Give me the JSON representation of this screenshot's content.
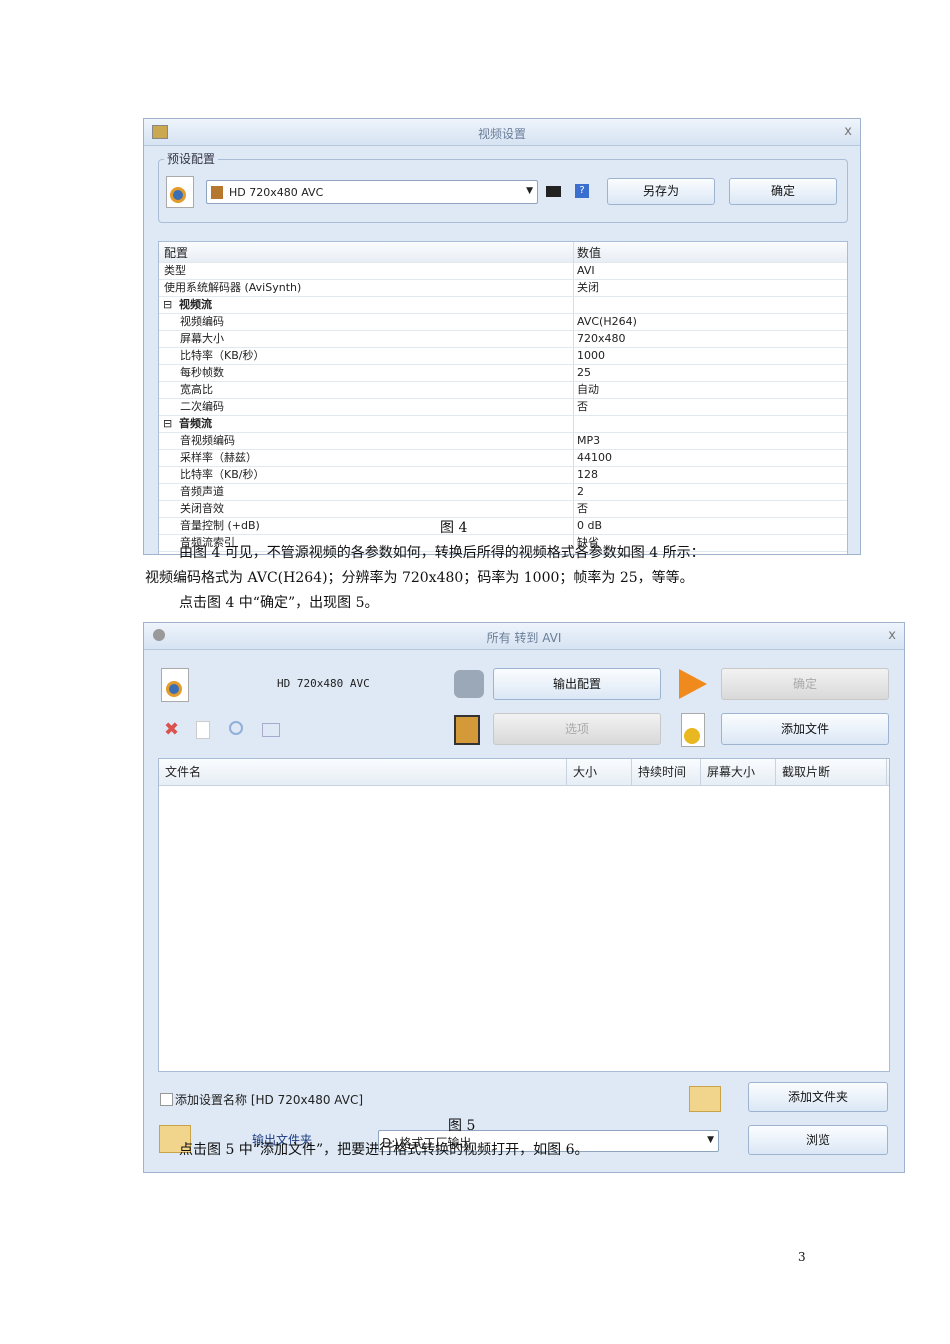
{
  "figure4": {
    "title": "视频设置",
    "close": "x",
    "preset_group": "预设配置",
    "preset_value": "HD 720x480 AVC",
    "save_as": "另存为",
    "ok": "确定",
    "help": "?",
    "col_config": "配置",
    "col_value": "数值",
    "rows": [
      {
        "k": "类型",
        "v": "AVI"
      },
      {
        "k": "使用系统解码器 (AviSynth)",
        "v": "关闭"
      },
      {
        "k": "视频流",
        "v": "",
        "section": true
      },
      {
        "k": "视频编码",
        "v": "AVC(H264)",
        "indent": true
      },
      {
        "k": "屏幕大小",
        "v": "720x480",
        "indent": true
      },
      {
        "k": "比特率（KB/秒）",
        "v": "1000",
        "indent": true
      },
      {
        "k": "每秒帧数",
        "v": "25",
        "indent": true
      },
      {
        "k": "宽高比",
        "v": "自动",
        "indent": true
      },
      {
        "k": "二次编码",
        "v": "否",
        "indent": true
      },
      {
        "k": "音频流",
        "v": "",
        "section": true
      },
      {
        "k": "音视频编码",
        "v": "MP3",
        "indent": true
      },
      {
        "k": "采样率（赫兹）",
        "v": "44100",
        "indent": true
      },
      {
        "k": "比特率（KB/秒）",
        "v": "128",
        "indent": true
      },
      {
        "k": "音频声道",
        "v": "2",
        "indent": true
      },
      {
        "k": "关闭音效",
        "v": "否",
        "indent": true
      },
      {
        "k": "音量控制 (+dB)",
        "v": "0 dB",
        "indent": true
      },
      {
        "k": "音频流索引",
        "v": "缺省",
        "indent": true
      }
    ],
    "caption": "图 4"
  },
  "text": {
    "p1": "由图 4 可见，不管源视频的各参数如何，转换后所得的视频格式各参数如图 4 所示：",
    "p2": "视频编码格式为 AVC(H264)；分辨率为 720x480；码率为 1000；帧率为 25，等等。",
    "p3": "点击图 4 中“确定”，出现图 5。",
    "p4": "点击图 5 中“添加文件”，把要进行格式转换的视频打开，如图 6。",
    "page_number": "3"
  },
  "figure5": {
    "title": "所有 转到 AVI",
    "close": "x",
    "preset": "HD 720x480 AVC",
    "output_config": "输出配置",
    "ok": "确定",
    "options": "选项",
    "add_file": "添加文件",
    "columns": [
      "文件名",
      "大小",
      "持续时间",
      "屏幕大小",
      "截取片断"
    ],
    "add_setting_name": "添加设置名称 [HD 720x480 AVC]",
    "add_folder": "添加文件夹",
    "output_folder_label": "输出文件夹",
    "output_folder": "D:\\格式工厂输出",
    "browse": "浏览",
    "caption": "图 5"
  }
}
